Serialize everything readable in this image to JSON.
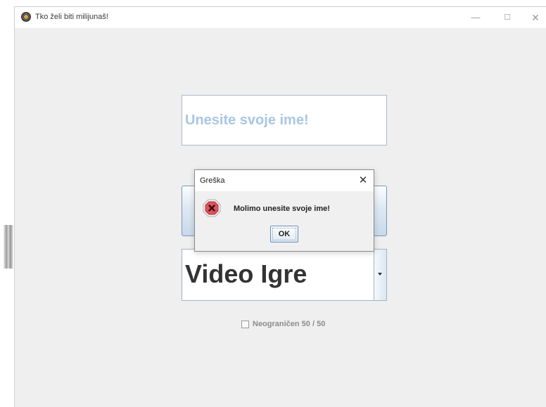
{
  "window": {
    "title": "Tko želi biti milijunaš!",
    "minimize_glyph": "—",
    "maximize_glyph": "☐",
    "close_glyph": "✕"
  },
  "form": {
    "name_placeholder": "Unesite svoje ime!",
    "category_selected": "Video Igre",
    "fifty_fifty_label": "Neograničen 50 / 50"
  },
  "dialog": {
    "title": "Greška",
    "close_glyph": "✕",
    "message": "Molimo unesite svoje ime!",
    "ok_label": "OK",
    "icon": "error-icon"
  },
  "colors": {
    "placeholder": "#a9c6e3",
    "error_icon": "#e0525c"
  }
}
